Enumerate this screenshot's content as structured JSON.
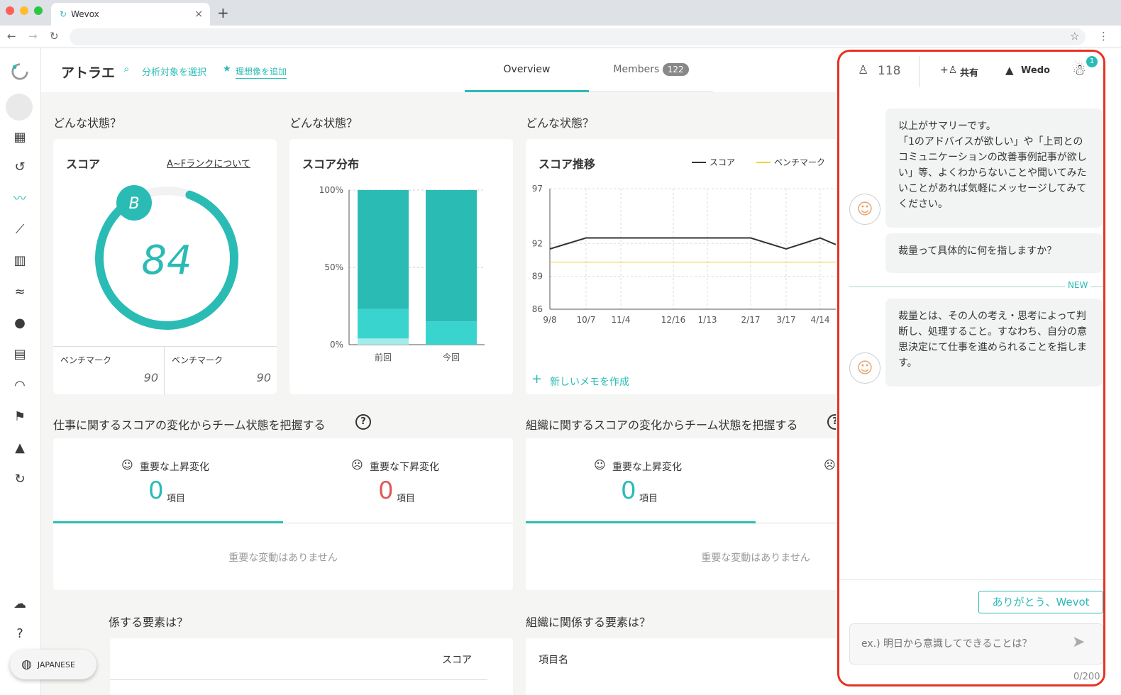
{
  "browser": {
    "tab_title": "Wevox",
    "close": "×",
    "new_tab": "+"
  },
  "header": {
    "title": "アトラエ",
    "select_target": "分析対象を選択",
    "add_ideal": "理想像を追加",
    "tabs": [
      {
        "label": "Overview",
        "active": true
      },
      {
        "label": "Members",
        "badge": "122"
      }
    ]
  },
  "state_sections": [
    "どんな状態？",
    "どんな状態？",
    "どんな状態？"
  ],
  "score_card": {
    "title": "スコア",
    "rank_link": "A~Fランクについて",
    "rank": "B",
    "score": "84",
    "score_fraction": 0.84,
    "benchmarks": [
      {
        "label": "ベンチマーク",
        "value": "90"
      },
      {
        "label": "ベンチマーク",
        "value": "90"
      }
    ]
  },
  "dist_card": {
    "title": "スコア分布"
  },
  "trend_card": {
    "title": "スコア推移",
    "legend": [
      "スコア",
      "ベンチマーク"
    ],
    "new_memo": "新しいメモを作成"
  },
  "chart_data": [
    {
      "type": "bar",
      "title": "スコア分布",
      "categories": [
        "前回",
        "今回"
      ],
      "yticks": [
        "100%",
        "50%",
        "0%"
      ],
      "ylim": [
        0,
        100
      ],
      "series": [
        {
          "values": [
            4,
            0
          ]
        },
        {
          "values": [
            19,
            15
          ]
        },
        {
          "values": [
            77,
            85
          ]
        }
      ]
    },
    {
      "type": "line",
      "title": "スコア推移",
      "x": [
        "9/8",
        "10/7",
        "11/4",
        "12/16",
        "1/13",
        "2/17",
        "3/17",
        "4/14"
      ],
      "yticks": [
        97,
        92,
        89,
        86
      ],
      "ylim": [
        86,
        97
      ],
      "series": [
        {
          "name": "スコア",
          "color": "#333333",
          "values": [
            91.5,
            92.5,
            92.5,
            92.5,
            92.5,
            92.5,
            91.5,
            92.5
          ]
        },
        {
          "name": "ベンチマーク",
          "color": "#f0d43a",
          "values": [
            90.3,
            90.3,
            90.3,
            90.3,
            90.3,
            90.3,
            90.3,
            90.3
          ]
        }
      ]
    }
  ],
  "work_section": {
    "title": "仕事に関するスコアの変化からチーム状態を把握する",
    "up_label": "重要な上昇変化",
    "up_count": "0",
    "down_label": "重要な下昇変化",
    "down_count": "0",
    "unit": "項目",
    "empty": "重要な変動はありません"
  },
  "org_section": {
    "title": "組織に関するスコアの変化からチーム状態を把握する",
    "up_label": "重要な上昇変化",
    "up_count": "0",
    "unit": "項目",
    "empty": "重要な変動はありません"
  },
  "bottom": {
    "left_title": "係する要素は？",
    "left_col": "スコア",
    "right_title": "組織に関係する要素は？",
    "right_col": "項目名"
  },
  "language": "JAPANESE",
  "chat": {
    "user_count": "118",
    "share": "共有",
    "wedo": "Wedo",
    "notif": "1",
    "messages": [
      {
        "from": "bot",
        "text": "以上がサマリーです。\n「1のアドバイスが欲しい」や「上司とのコミュニケーションの改善事例記事が欲しい」等、よくわからないことや聞いてみたいことがあれば気軽にメッセージしてみてください。"
      },
      {
        "from": "user",
        "text": "裁量って具体的に何を指しますか？"
      },
      {
        "from": "bot",
        "text": "裁量とは、その人の考え・思考によって判断し、処理すること。すなわち、自分の意思決定にて仕事を進められることを指します。"
      }
    ],
    "new_label": "NEW",
    "thanks": "ありがとう、Wevot",
    "placeholder": "ex.) 明日から意識してできることは？",
    "counter": "0/200"
  }
}
